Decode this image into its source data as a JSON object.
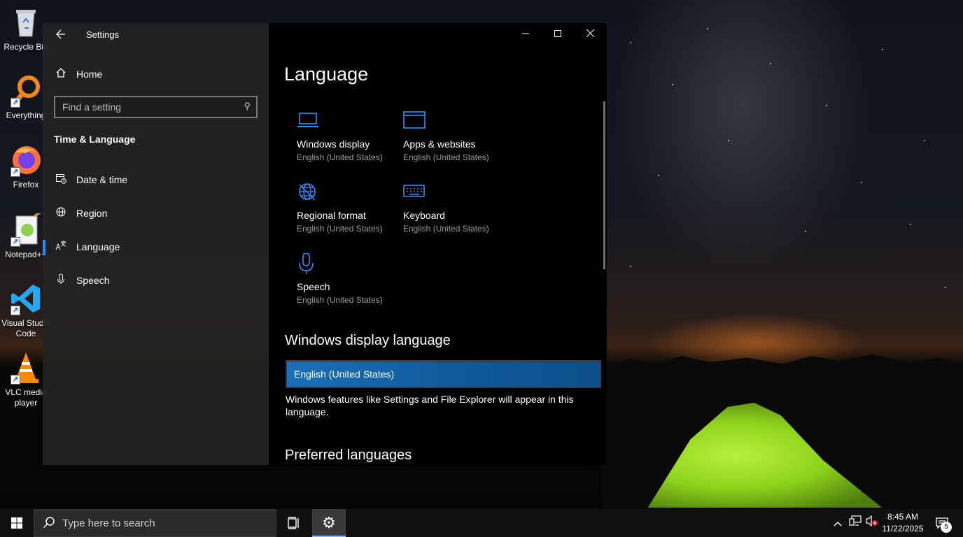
{
  "desktop": {
    "icons": [
      {
        "label": "Recycle Bin",
        "icon": "recycle-bin-icon"
      },
      {
        "label": "Everything",
        "icon": "everything-search-icon"
      },
      {
        "label": "Firefox",
        "icon": "firefox-icon"
      },
      {
        "label": "Notepad++",
        "icon": "notepad-plus-plus-icon"
      },
      {
        "label": "Visual Studio Code",
        "icon": "vscode-icon"
      },
      {
        "label": "VLC media player",
        "icon": "vlc-icon"
      }
    ]
  },
  "settings": {
    "window_title": "Settings",
    "sidebar": {
      "home_label": "Home",
      "search_placeholder": "Find a setting",
      "section_title": "Time & Language",
      "items": [
        {
          "label": "Date & time",
          "icon": "calendar-clock-icon"
        },
        {
          "label": "Region",
          "icon": "globe-icon"
        },
        {
          "label": "Language",
          "icon": "language-icon",
          "active": true
        },
        {
          "label": "Speech",
          "icon": "microphone-icon"
        }
      ]
    },
    "content": {
      "title": "Language",
      "tiles": [
        {
          "label": "Windows display",
          "sub": "English (United States)",
          "icon": "laptop-icon"
        },
        {
          "label": "Apps & websites",
          "sub": "English (United States)",
          "icon": "browser-window-icon"
        },
        {
          "label": "Regional format",
          "sub": "English (United States)",
          "icon": "globe-icon"
        },
        {
          "label": "Keyboard",
          "sub": "English (United States)",
          "icon": "keyboard-icon"
        },
        {
          "label": "Speech",
          "sub": "English (United States)",
          "icon": "microphone-icon"
        }
      ],
      "display_language_heading": "Windows display language",
      "display_language_value": "English (United States)",
      "display_language_desc": "Windows features like Settings and File Explorer will appear in this language.",
      "preferred_heading": "Preferred languages"
    }
  },
  "taskbar": {
    "search_placeholder": "Type here to search",
    "time": "8:45 AM",
    "date": "11/22/2025",
    "notification_count": "5"
  },
  "colors": {
    "accent": "#1f8fff",
    "icon_blue": "#2f8fff",
    "select_bg": "#1c6fb8"
  }
}
